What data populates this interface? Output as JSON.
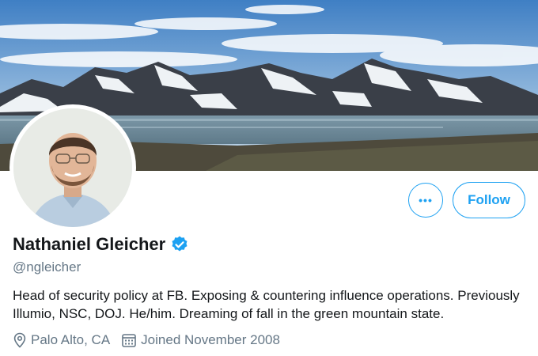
{
  "profile": {
    "name": "Nathaniel Gleicher",
    "handle": "@ngleicher",
    "bio": "Head of security policy at FB. Exposing & countering influence operations. Previously Illumio, NSC, DOJ. He/him. Dreaming of fall in the green mountain state.",
    "verified": true,
    "location": "Palo Alto, CA",
    "joined": "Joined November 2008"
  },
  "actions": {
    "more_label": "•••",
    "follow_label": "Follow"
  },
  "icons": {
    "verified": "verified-badge-icon",
    "location": "location-pin-icon",
    "calendar": "calendar-icon",
    "more": "more-options-icon"
  },
  "colors": {
    "accent": "#1da1f2",
    "secondary_text": "#657786",
    "primary_text": "#14171a"
  }
}
